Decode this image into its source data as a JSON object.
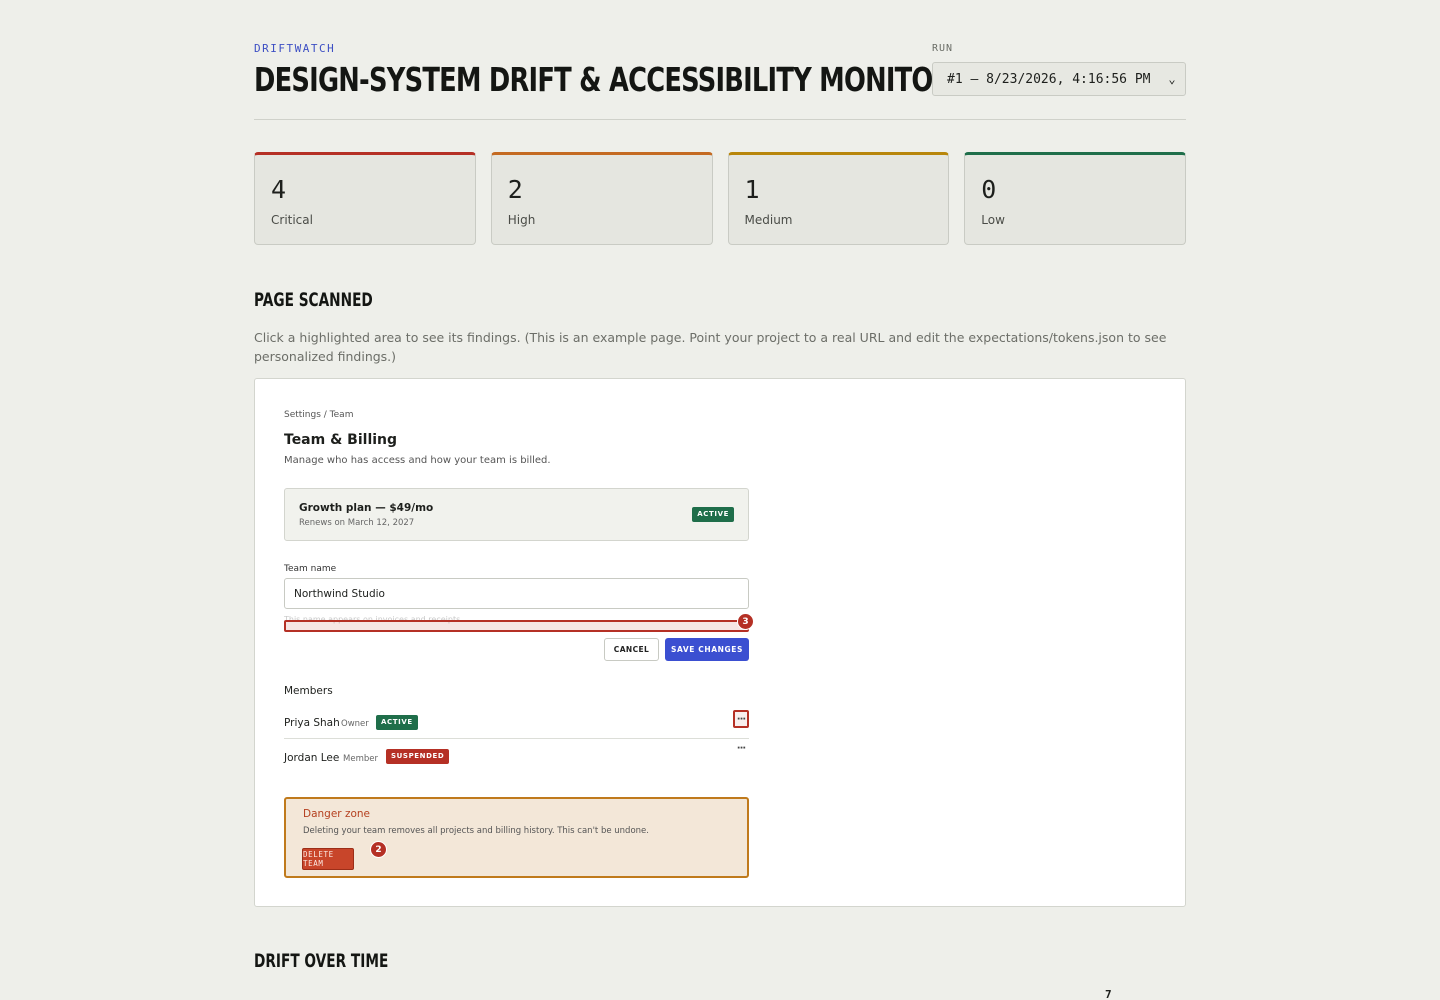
{
  "header": {
    "brand": "DRIFTWATCH",
    "title": "DESIGN-SYSTEM DRIFT & ACCESSIBILITY MONITOR",
    "run_label": "RUN",
    "run_selected": "#1 — 8/23/2026, 4:16:56 PM"
  },
  "severity": [
    {
      "count": "4",
      "label": "Critical",
      "color": "#b53025"
    },
    {
      "count": "2",
      "label": "High",
      "color": "#c46a22"
    },
    {
      "count": "1",
      "label": "Medium",
      "color": "#b8860b"
    },
    {
      "count": "0",
      "label": "Low",
      "color": "#1f6e4a"
    }
  ],
  "page_scanned": {
    "title": "PAGE SCANNED",
    "description": "Click a highlighted area to see its findings. (This is an example page. Point your project to a real URL and edit the expectations/tokens.json to see personalized findings.)"
  },
  "preview": {
    "breadcrumb": "Settings / Team",
    "title": "Team & Billing",
    "subtitle": "Manage who has access and how your team is billed.",
    "plan": {
      "name": "Growth plan — $49/mo",
      "renews": "Renews on March 12, 2027",
      "status": "ACTIVE"
    },
    "team_name_label": "Team name",
    "team_name_value": "Northwind Studio",
    "hint": "This name appears on invoices and receipts.",
    "cancel_label": "CANCEL",
    "save_label": "SAVE CHANGES",
    "members_title": "Members",
    "members": [
      {
        "name": "Priya Shah",
        "role": "Owner",
        "status": "ACTIVE",
        "more": "···"
      },
      {
        "name": "Jordan Lee",
        "role": "Member",
        "status": "SUSPENDED",
        "more": "···"
      }
    ],
    "danger": {
      "title": "Danger zone",
      "description": "Deleting your team removes all projects and billing history. This can't be undone.",
      "button": "DELETE TEAM"
    },
    "markers": {
      "hint": "3",
      "delete": "2"
    }
  },
  "drift": {
    "title": "DRIFT OVER TIME",
    "peek_value": "7"
  }
}
